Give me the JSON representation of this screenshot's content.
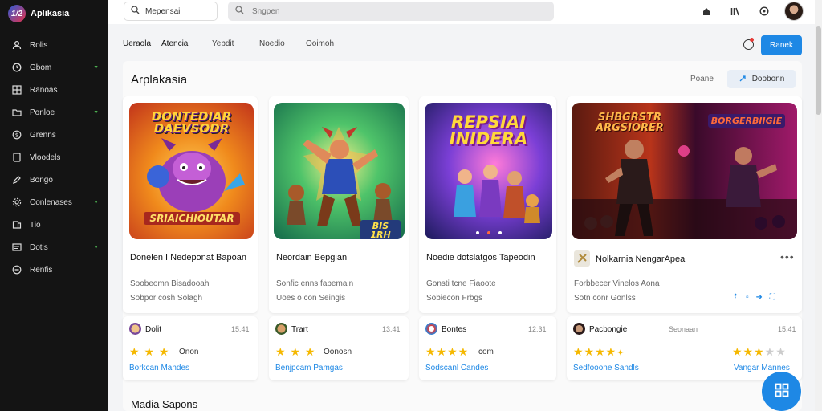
{
  "app": {
    "name": "Aplikasia",
    "logo_text": "1/2"
  },
  "sidebar": {
    "items": [
      {
        "label": "Rolis",
        "icon": "user-icon",
        "chevron": false
      },
      {
        "label": "Gbom",
        "icon": "clock-icon",
        "chevron": true
      },
      {
        "label": "Ranoas",
        "icon": "grid-icon",
        "chevron": false
      },
      {
        "label": "Ponloe",
        "icon": "folder-icon",
        "chevron": true
      },
      {
        "label": "Grenns",
        "icon": "dollar-icon",
        "chevron": false
      },
      {
        "label": "Vloodels",
        "icon": "shield-icon",
        "chevron": false
      },
      {
        "label": "Bongo",
        "icon": "pen-icon",
        "chevron": false
      },
      {
        "label": "Conlenases",
        "icon": "gear-icon",
        "chevron": true
      },
      {
        "label": "Tio",
        "icon": "book-icon",
        "chevron": false
      },
      {
        "label": "Dotis",
        "icon": "doc-icon",
        "chevron": true
      },
      {
        "label": "Renfis",
        "icon": "minus-circle-icon",
        "chevron": false
      }
    ]
  },
  "topbar": {
    "search1_value": "Mepensai",
    "search2_placeholder": "Sngpen"
  },
  "tabs": [
    "Ueraola",
    "Atencia",
    "Yebdit",
    "Noedio",
    "Ooimoh"
  ],
  "header_button": "Ranek",
  "panel": {
    "title": "Arplakasia",
    "link": "Poane",
    "button": "Doobonn"
  },
  "apps": [
    {
      "title": "Donelen I Nedeponat Bapoan",
      "sub1": "Soobeomn Bisadooah",
      "sub2": "Sobpor cosh Solagh",
      "thumb_text": "DONTEDIAR DAEVSODR",
      "thumb_badge": "SRIAICHIOUTAR"
    },
    {
      "title": "Neordain Bepgian",
      "sub1": "Sonfic enns fapemain",
      "sub2": "Uoes o con Seingis",
      "thumb_text": "",
      "thumb_badge": "BIS 1RH"
    },
    {
      "title": "Noedie dotslatgos Tapeodin",
      "sub1": "Gonsti tcne Fiaoote",
      "sub2": "Sobiecon Frbgs",
      "thumb_text": "REPSIAI INIDERA",
      "thumb_badge": ""
    },
    {
      "title": "Nolkarnia NengarApea",
      "sub1": "Forbbecer Vinelos Aona",
      "sub2": "Sotn conr Gonlss",
      "thumb_text": "SHBGRSTR ARGSIORER",
      "thumb_badge": "BORGERBIIGIE"
    }
  ],
  "reviews": [
    {
      "name": "Dolit",
      "date": "15:41",
      "stars": 3,
      "rating_label": "Onon",
      "link": "Borkcan Mandes"
    },
    {
      "name": "Trart",
      "date": "13:41",
      "stars": 3,
      "rating_label": "Oonosn",
      "link": "Benjpcam Pamgas"
    },
    {
      "name": "Bontes",
      "date": "12:31",
      "stars": 4,
      "rating_label": "com",
      "link": "Sodscanl Candes"
    },
    {
      "name": "Pacbongie",
      "date": "",
      "stars": 4,
      "rating_label": "",
      "link": "Sedfooone Sandls"
    },
    {
      "name": "",
      "date": "Seonaan",
      "stars": 3,
      "rating_label": "",
      "link": "Vangar Mannes"
    }
  ],
  "section_title": "Madia Sapons",
  "colors": {
    "accent": "#1e88e5",
    "sidebar": "#141414",
    "star": "#f5b800"
  }
}
